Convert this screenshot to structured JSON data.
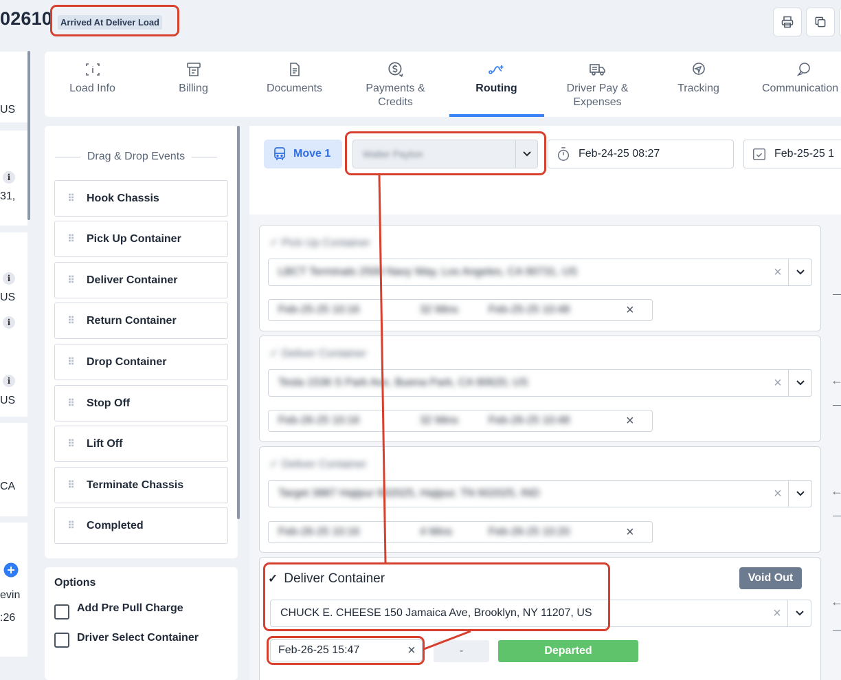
{
  "header": {
    "load_number": "02610",
    "status": "Arrived At Deliver Load",
    "print_icon": "printer-icon",
    "copy_icon": "copy-icon"
  },
  "left_strip": {
    "texts": [
      "US",
      "31,",
      "US",
      "US",
      "CA",
      "evin",
      ":26"
    ]
  },
  "tabs": [
    {
      "label": "Load Info",
      "icon": "load-info-icon"
    },
    {
      "label": "Billing",
      "icon": "billing-icon"
    },
    {
      "label": "Documents",
      "icon": "document-icon"
    },
    {
      "label": "Payments & Credits",
      "icon": "payments-icon"
    },
    {
      "label": "Routing",
      "icon": "routing-icon",
      "active": true
    },
    {
      "label": "Driver Pay & Expenses",
      "icon": "truck-icon"
    },
    {
      "label": "Tracking",
      "icon": "tracking-icon"
    },
    {
      "label": "Communication",
      "icon": "chat-icon"
    }
  ],
  "events_panel": {
    "heading": "Drag & Drop Events",
    "items": [
      "Hook Chassis",
      "Pick Up Container",
      "Deliver Container",
      "Return Container",
      "Drop Container",
      "Stop Off",
      "Lift Off",
      "Terminate Chassis",
      "Completed"
    ]
  },
  "options": {
    "title": "Options",
    "items": [
      "Add Pre Pull Charge",
      "Driver Select Container"
    ]
  },
  "routing": {
    "move_label": "Move 1",
    "driver": "Walter Payton",
    "start_time": "Feb-24-25 08:27",
    "end_time": "Feb-25-25 1",
    "events": [
      {
        "title": "Pick Up Container",
        "address": "LBCT Terminals 2500 Navy Way, Los Angeles, CA 90731, US",
        "arrived": "Feb-25-25 10:16",
        "duration": "32 Mins",
        "departed": "Feb-25-25 10:48"
      },
      {
        "title": "Deliver Container",
        "address": "Tesla 1536 S Park Ave, Buena Park, CA 90620, US",
        "arrived": "Feb-26-25 10:16",
        "duration": "32 Mins",
        "departed": "Feb-26-25 10:48"
      },
      {
        "title": "Deliver Container",
        "address": "Target 3887 Hajipur 602025, Hajipur, TN 602025, IND",
        "arrived": "Feb-26-25 10:16",
        "duration": "4 Mins",
        "departed": "Feb-26-25 10:20"
      }
    ],
    "active_event": {
      "title": "Deliver Container",
      "address": "CHUCK E. CHEESE 150 Jamaica Ave, Brooklyn, NY 11207, US",
      "arrived": "Feb-26-25 15:47",
      "duration": "-",
      "void_label": "Void Out",
      "status_label": "Departed"
    }
  },
  "colors": {
    "accent": "#3b82f6",
    "annotation": "#d8402e",
    "departed": "#5ec36a"
  }
}
